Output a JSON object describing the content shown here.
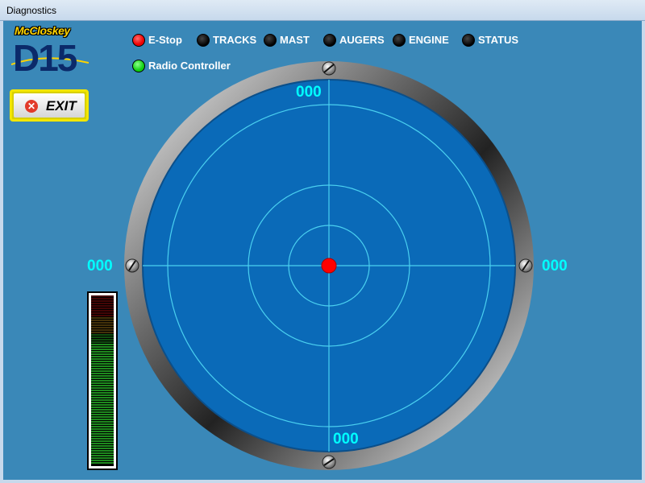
{
  "window": {
    "title": "Diagnostics"
  },
  "logo": {
    "brand": "McCloskey",
    "model": "D15"
  },
  "exit_button": {
    "label": "EXIT",
    "icon": "close-circle-icon"
  },
  "indicators": [
    {
      "label": "E-Stop",
      "state": "red"
    },
    {
      "label": "TRACKS",
      "state": "off"
    },
    {
      "label": "MAST",
      "state": "off"
    },
    {
      "label": "AUGERS",
      "state": "off"
    },
    {
      "label": "ENGINE",
      "state": "off"
    },
    {
      "label": "STATUS",
      "state": "off"
    },
    {
      "label": "Radio Controller",
      "state": "green"
    }
  ],
  "dial": {
    "top": "000",
    "left": "000",
    "right": "000",
    "bottom": "000",
    "ring_color": "#8a8a8a",
    "face_color": "#0a6ab8",
    "grid_color": "#4ad0f0",
    "center_dot_color": "#ff0000"
  },
  "level_meter": {
    "level": 0.72,
    "colors": {
      "low": "#1e8a1e",
      "mid": "#7a5a10",
      "high": "#7a0a0a"
    }
  }
}
